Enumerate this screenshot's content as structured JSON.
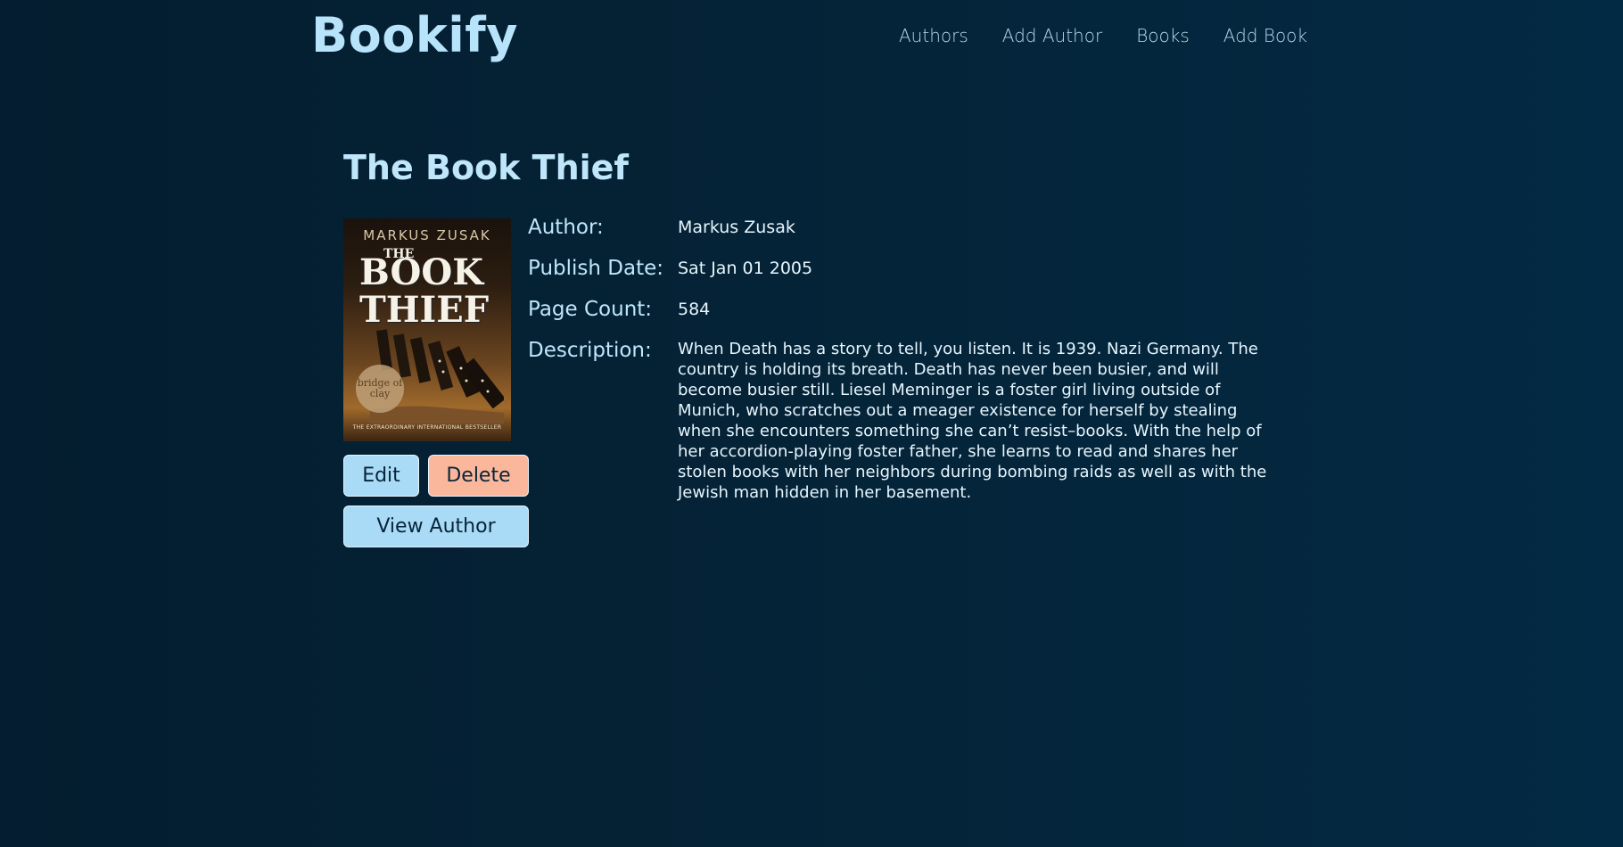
{
  "header": {
    "brand": "Bookify",
    "nav": [
      "Authors",
      "Add Author",
      "Books",
      "Add Book"
    ]
  },
  "book": {
    "title": "The Book Thief",
    "cover": {
      "author_text": "MARKUS ZUSAK",
      "title_small": "THE",
      "title_big": "BOOK THIEF",
      "badge_text": "bridge of clay",
      "tagline": "THE EXTRAORDINARY INTERNATIONAL BESTSELLER"
    },
    "details": [
      {
        "label": "Author:",
        "value": "Markus Zusak"
      },
      {
        "label": "Publish Date:",
        "value": "Sat Jan 01 2005"
      },
      {
        "label": "Page Count:",
        "value": "584"
      },
      {
        "label": "Description:",
        "value": "When Death has a story to tell, you listen. It is 1939. Nazi Germany. The country is holding its breath. Death has never been busier, and will become busier still. Liesel Meminger is a foster girl living outside of Munich, who scratches out a meager existence for herself by stealing when she encounters something she can’t resist–books. With the help of her accordion-playing foster father, she learns to read and shares her stolen books with her neighbors during bombing raids as well as with the Jewish man hidden in her basement."
      }
    ]
  },
  "actions": {
    "edit": "Edit",
    "delete": "Delete",
    "view_author": "View Author"
  },
  "colors": {
    "background": "#041d30",
    "brand": "#b7e3fb",
    "primary_button": "#a9dbf7",
    "danger_button": "#fbb79b"
  }
}
